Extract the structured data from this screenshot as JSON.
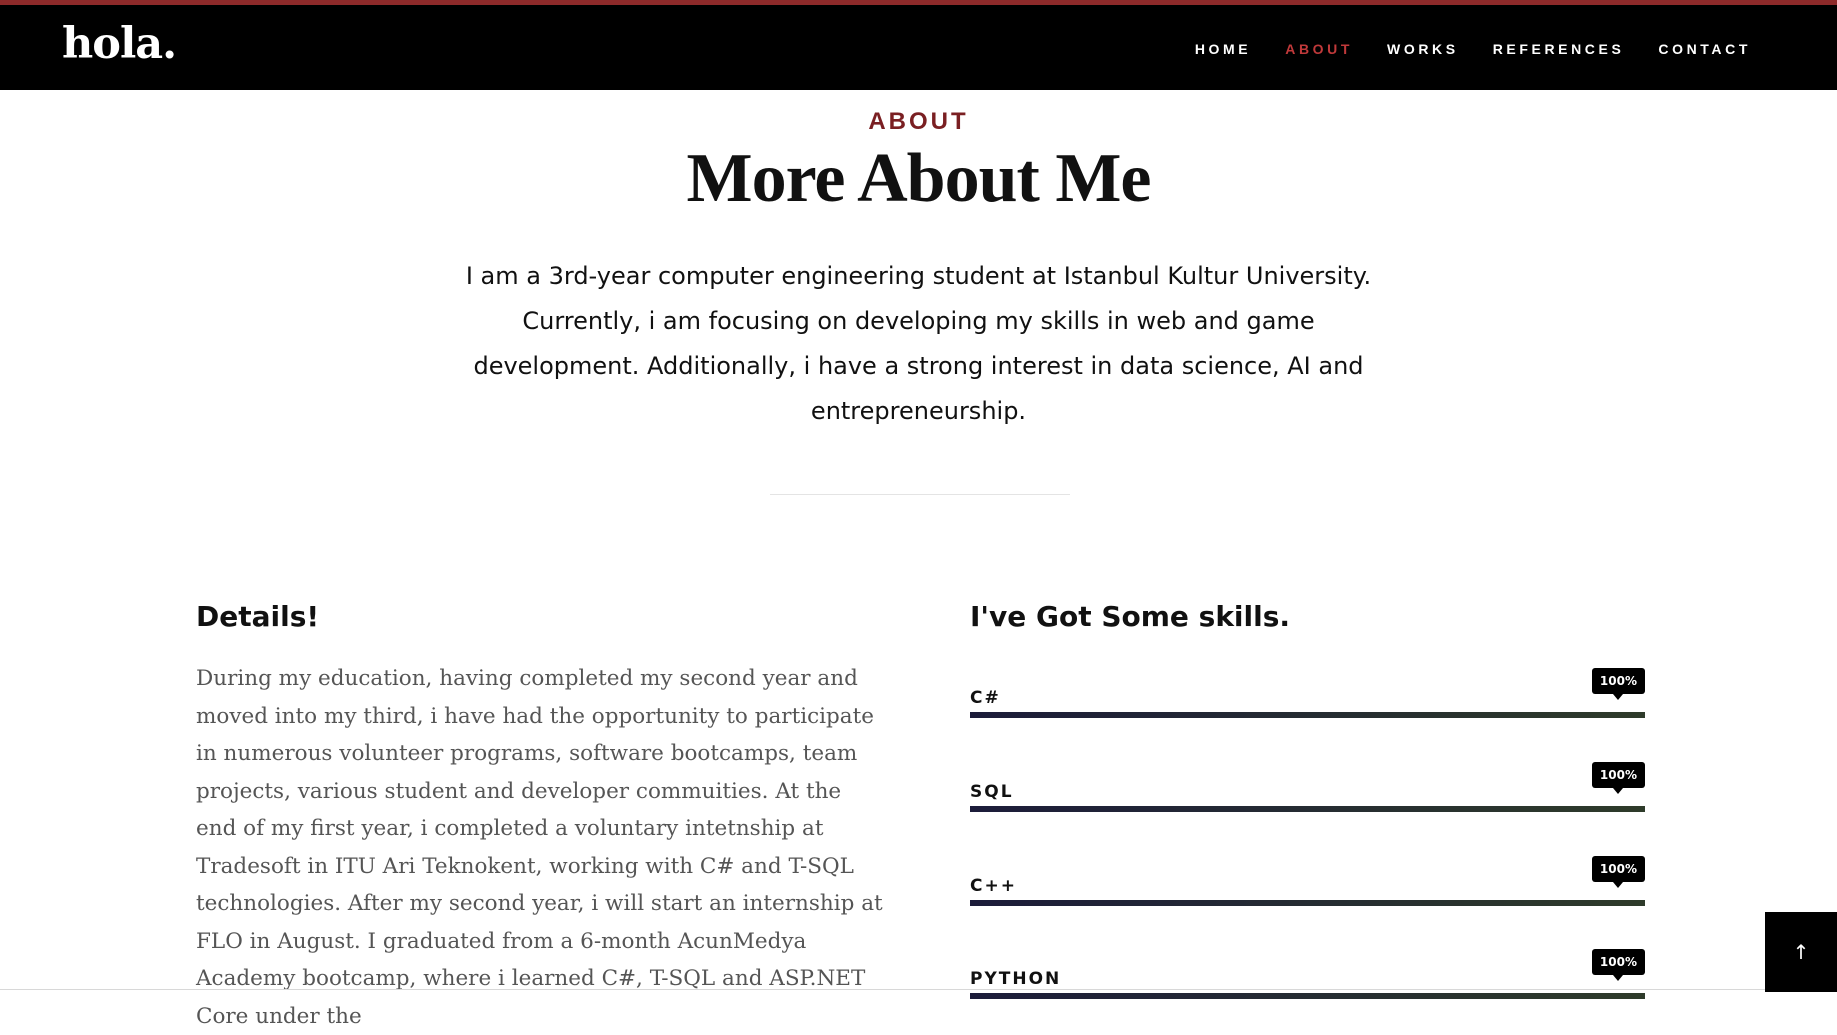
{
  "header": {
    "logo": "hola.",
    "nav": [
      {
        "label": "HOME",
        "active": false
      },
      {
        "label": "ABOUT",
        "active": true
      },
      {
        "label": "WORKS",
        "active": false
      },
      {
        "label": "REFERENCES",
        "active": false
      },
      {
        "label": "CONTACT",
        "active": false
      }
    ]
  },
  "intro": {
    "kicker": "ABOUT",
    "headline": "More About Me",
    "lead": "I am a 3rd-year computer engineering student at Istanbul Kultur University. Currently, i am focusing on developing my skills in web and game development. Additionally, i have a strong interest in data science, AI and entrepreneurship."
  },
  "details": {
    "title": "Details!",
    "text": "During my education, having completed my second year and moved into my third, i have had the opportunity to participate in numerous volunteer programs, software bootcamps, team projects, various student and developer commuities. At the end of my first year, i completed a voluntary intetnship at Tradesoft in ITU Ari Teknokent, working with C# and T-SQL technologies. After my second year, i will start an internship at FLO in August. I graduated from a 6-month AcunMedya Academy bootcamp, where i learned C#, T-SQL and ASP.NET Core under the"
  },
  "skills": {
    "title": "I've Got Some skills.",
    "items": [
      {
        "name": "C#",
        "percent_label": "100%",
        "level": 1.0
      },
      {
        "name": "SQL",
        "percent_label": "100%",
        "level": 1.0
      },
      {
        "name": "C++",
        "percent_label": "100%",
        "level": 1.0
      },
      {
        "name": "PYTHON",
        "percent_label": "100%",
        "level": 1.0
      }
    ]
  },
  "back_to_top": {
    "icon": "arrow-up-icon",
    "glyph": "↑"
  },
  "colors": {
    "accent": "#c0393a",
    "kicker": "#7a1f22",
    "topbar": "#000000"
  }
}
